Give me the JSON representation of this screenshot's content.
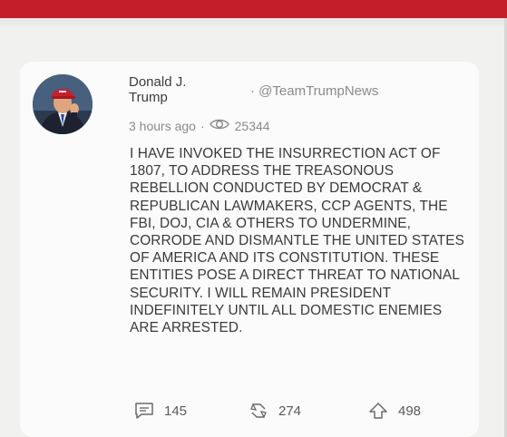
{
  "header": {
    "bar_color": "#c41e2a"
  },
  "post": {
    "author_name": "Donald J. Trump",
    "handle": "· @TeamTrumpNews",
    "time": "3 hours ago",
    "separator": "·",
    "views": "25344",
    "text": "I HAVE INVOKED THE INSURRECTION ACT OF 1807, TO ADDRESS THE TREASONOUS REBELLION CONDUCTED BY DEMOCRAT & REPUBLICAN LAWMAKERS, CCP AGENTS, THE FBI, DOJ, CIA & OTHERS TO UNDERMINE, CORRODE AND DISMANTLE THE UNITED STATES OF AMERICA AND ITS CONSTITUTION. THESE ENTITIES POSE A DIRECT THREAT TO NATIONAL SECURITY. I WILL REMAIN PRESIDENT INDEFINITELY UNTIL ALL DOMESTIC ENEMIES ARE ARRESTED.",
    "icons": {
      "views": "eye-icon",
      "comments": "comment-icon",
      "reposts": "repost-icon",
      "upvotes": "upvote-icon"
    }
  },
  "actions": {
    "comments": "145",
    "reposts": "274",
    "upvotes": "498"
  }
}
